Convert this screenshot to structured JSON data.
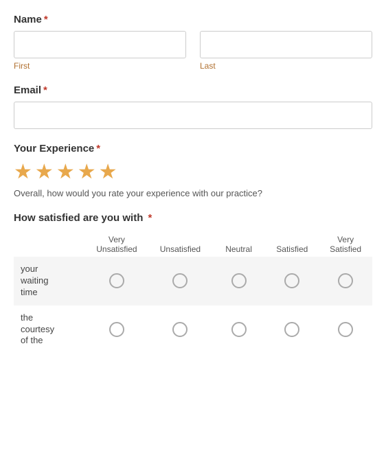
{
  "form": {
    "name_label": "Name",
    "required_marker": "*",
    "first_label": "First",
    "last_label": "Last",
    "email_label": "Email",
    "experience_label": "Your Experience",
    "experience_note": "Overall, how would you rate your experience with our practice?",
    "stars": [
      {
        "filled": true
      },
      {
        "filled": true
      },
      {
        "filled": true
      },
      {
        "filled": true
      },
      {
        "filled": true
      }
    ],
    "satisfaction_label": "How satisfied are you with",
    "columns": [
      {
        "label": "Very\nUnsatisfied"
      },
      {
        "label": "Unsatisfied"
      },
      {
        "label": "Neutral"
      },
      {
        "label": "Satisfied"
      },
      {
        "label": "Very\nSatisfied"
      }
    ],
    "rows": [
      {
        "label": "your waiting time",
        "selected": null
      },
      {
        "label": "the courtesy of the",
        "selected": null
      }
    ]
  },
  "colors": {
    "required": "#c0392b",
    "star_filled": "#e8a84c",
    "sub_label": "#b07030",
    "header_bg": "#f5f5f5"
  }
}
